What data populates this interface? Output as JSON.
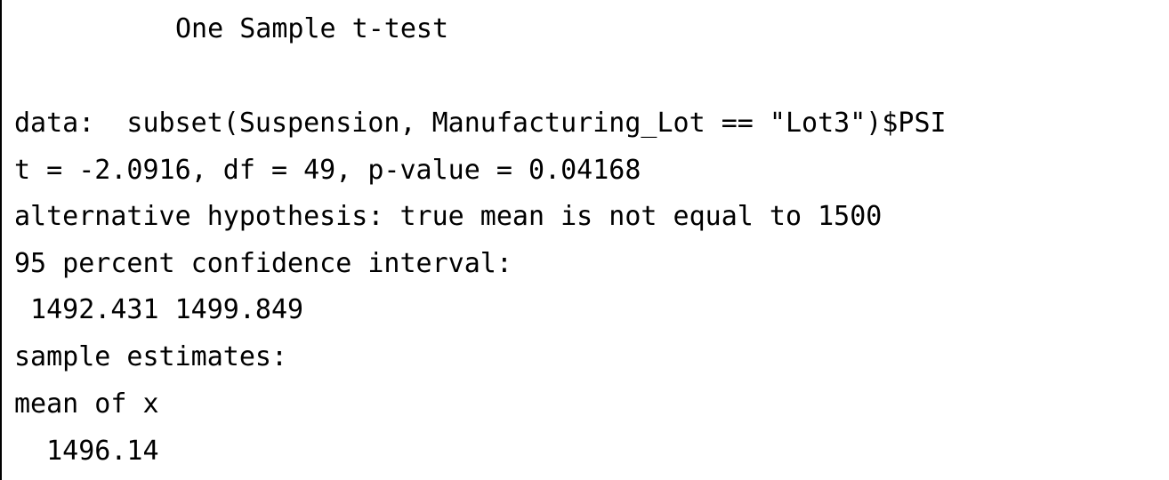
{
  "console": {
    "title": "One Sample t-test",
    "data_line": "data:  subset(Suspension, Manufacturing_Lot == \"Lot3\")$PSI",
    "stat_line": "t = -2.0916, df = 49, p-value = 0.04168",
    "alternative_line": "alternative hypothesis: true mean is not equal to 1500",
    "ci_label": "95 percent confidence interval:",
    "ci_values": " 1492.431 1499.849",
    "estimates_label": "sample estimates:",
    "mean_label": "mean of x",
    "mean_value": "  1496.14"
  }
}
